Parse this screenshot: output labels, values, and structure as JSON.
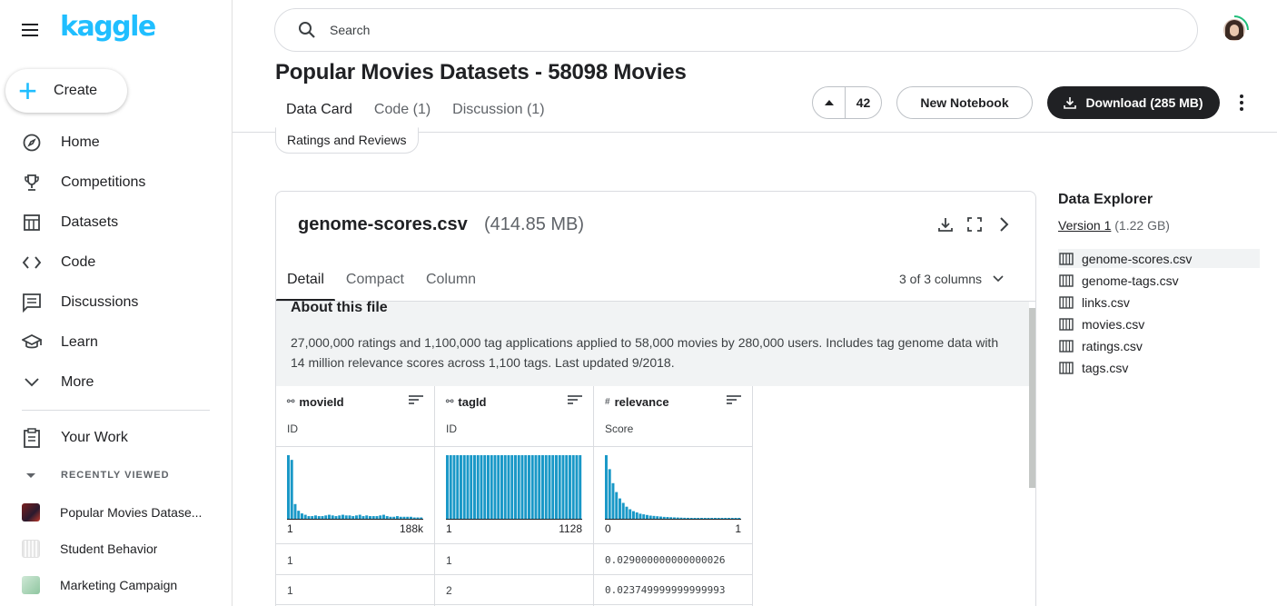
{
  "app": {
    "logo": "kaggle"
  },
  "sidebar": {
    "create_label": "Create",
    "items": [
      {
        "label": "Home",
        "icon": "compass-icon"
      },
      {
        "label": "Competitions",
        "icon": "trophy-icon"
      },
      {
        "label": "Datasets",
        "icon": "table-icon"
      },
      {
        "label": "Code",
        "icon": "code-icon"
      },
      {
        "label": "Discussions",
        "icon": "comments-icon"
      },
      {
        "label": "Learn",
        "icon": "school-icon"
      },
      {
        "label": "More",
        "icon": "chevron-down-icon"
      }
    ],
    "your_work": "Your Work",
    "recently_viewed_label": "RECENTLY VIEWED",
    "recent": [
      {
        "label": "Popular Movies Datase..."
      },
      {
        "label": "Student Behavior"
      },
      {
        "label": "Marketing Campaign"
      }
    ]
  },
  "search": {
    "placeholder": "Search"
  },
  "dataset": {
    "title": "Popular Movies Datasets - 58098 Movies",
    "tabs": [
      "Data Card",
      "Code (1)",
      "Discussion (1)"
    ],
    "votes": "42",
    "new_notebook": "New Notebook",
    "download": "Download (285 MB)",
    "tag_chip": "Ratings and Reviews"
  },
  "file": {
    "name": "genome-scores.csv",
    "size": "(414.85 MB)",
    "subtabs": [
      "Detail",
      "Compact",
      "Column"
    ],
    "columns_selector": "3 of 3 columns",
    "about_title": "About this file",
    "about_text": "27,000,000 ratings and 1,100,000 tag applications applied to 58,000 movies by 280,000 users. Includes tag genome data with 14 million relevance scores across 1,100 tags. Last updated 9/2018.",
    "columns": [
      {
        "type_symbol": "⚯",
        "name": "movieId",
        "desc": "ID",
        "min": "1",
        "max": "188k",
        "values": [
          "1",
          "1"
        ]
      },
      {
        "type_symbol": "⚯",
        "name": "tagId",
        "desc": "ID",
        "min": "1",
        "max": "1128",
        "values": [
          "1",
          "2"
        ]
      },
      {
        "type_symbol": "#",
        "name": "relevance",
        "desc": "Score",
        "min": "0",
        "max": "1",
        "values": [
          "0.029000000000000026",
          "0.023749999999999993"
        ]
      }
    ]
  },
  "explorer": {
    "title": "Data Explorer",
    "version_link": "Version 1",
    "version_size": "(1.22 GB)",
    "files": [
      "genome-scores.csv",
      "genome-tags.csv",
      "links.csv",
      "movies.csv",
      "ratings.csv",
      "tags.csv"
    ]
  },
  "chart_data": [
    {
      "type": "bar",
      "series": [
        {
          "name": "movieId",
          "values": [
            95,
            88,
            22,
            12,
            8,
            6,
            4,
            4,
            5,
            4,
            4,
            5,
            6,
            5,
            4,
            5,
            6,
            5,
            5,
            4,
            5,
            6,
            4,
            5,
            4,
            4,
            4,
            5,
            6,
            4,
            3,
            3,
            4,
            3,
            3,
            3,
            3,
            2,
            2,
            2
          ]
        }
      ]
    },
    {
      "type": "bar",
      "series": [
        {
          "name": "tagId",
          "values": [
            100,
            100,
            100,
            100,
            100,
            100,
            100,
            100,
            100,
            100,
            100,
            100,
            100,
            100,
            100,
            100,
            100,
            100,
            100,
            100,
            100,
            100,
            100,
            100,
            100,
            100,
            100,
            100,
            100,
            100,
            100,
            100,
            100,
            100,
            100,
            100,
            100,
            100,
            100,
            100
          ]
        }
      ]
    },
    {
      "type": "bar",
      "series": [
        {
          "name": "relevance",
          "values": [
            100,
            78,
            56,
            42,
            32,
            25,
            19,
            15,
            12,
            10,
            8,
            7,
            6,
            5,
            4.5,
            4,
            3.5,
            3,
            2.8,
            2.5,
            2.2,
            2,
            1.8,
            1.6,
            1.5,
            1.4,
            1.3,
            1.2,
            1.1,
            1,
            1,
            1,
            0.9,
            0.9,
            0.8,
            0.8,
            0.8,
            0.7,
            0.7,
            0.7
          ]
        }
      ]
    }
  ],
  "colors": {
    "accent": "#20beff",
    "bar": "#1998c7"
  }
}
